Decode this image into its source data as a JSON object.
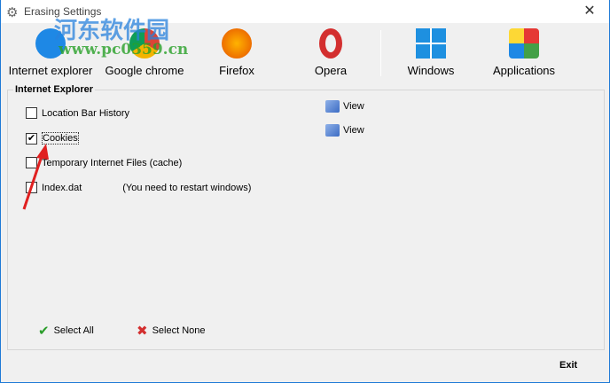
{
  "window": {
    "title": "Erasing Settings",
    "close": "✕"
  },
  "toolbar": [
    {
      "label": "Internet explorer",
      "color": "#1e88e5"
    },
    {
      "label": "Google chrome",
      "color": "#4caf50"
    },
    {
      "label": "Firefox",
      "color": "#e65100"
    },
    {
      "label": "Opera",
      "color": "#d32f2f"
    },
    {
      "label": "Windows",
      "color": "#1e90e0"
    },
    {
      "label": "Applications",
      "color": "#8e44ad"
    }
  ],
  "group": {
    "title": "Internet Explorer",
    "items": [
      {
        "label": "Location Bar History",
        "checked": false
      },
      {
        "label": "Cookies",
        "checked": true
      },
      {
        "label": "Temporary Internet Files (cache)",
        "checked": false
      },
      {
        "label": "Index.dat",
        "checked": false,
        "note": "(You need to restart windows)"
      }
    ],
    "view_labels": [
      "View",
      "View"
    ]
  },
  "buttons": {
    "select_all": "Select All",
    "select_none": "Select None",
    "exit": "Exit"
  },
  "watermark": {
    "cn": "河东软件园",
    "url": "www.pc0359.cn"
  }
}
